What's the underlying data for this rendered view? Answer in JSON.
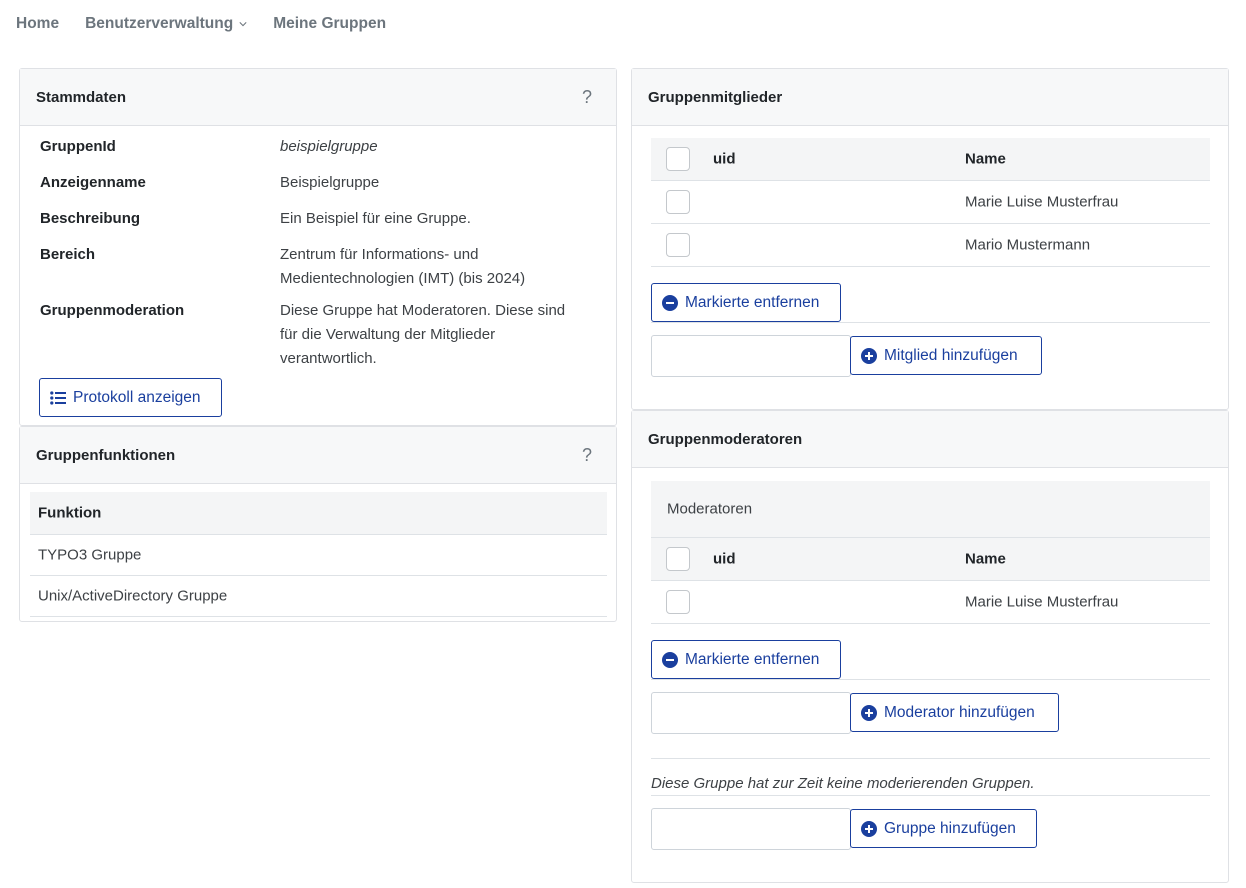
{
  "nav": {
    "home": "Home",
    "benutzerverwaltung": "Benutzerverwaltung",
    "meine_gruppen": "Meine Gruppen"
  },
  "stammdaten": {
    "title": "Stammdaten",
    "help": "?",
    "rows": [
      {
        "key": "GruppenId",
        "value": "beispielgruppe"
      },
      {
        "key": "Anzeigenname",
        "value": "Beispielgruppe"
      },
      {
        "key": "Beschreibung",
        "value": "Ein Beispiel für eine Gruppe."
      },
      {
        "key": "Bereich",
        "value_line1": "Zentrum für Informations- und",
        "value_line2": "Medientechnologien (IMT) (bis 2024)"
      },
      {
        "key": "Gruppenmoderation",
        "value_line1": "Diese Gruppe hat Moderatoren. Diese sind",
        "value_line2": "für die Verwaltung der Mitglieder",
        "value_line3": "verantwortlich."
      }
    ],
    "protokoll_button": "Protokoll anzeigen"
  },
  "gruppenfunktionen": {
    "title": "Gruppenfunktionen",
    "help": "?",
    "column": "Funktion",
    "rows": [
      "TYPO3 Gruppe",
      "Unix/ActiveDirectory Gruppe"
    ]
  },
  "gruppenmitglieder": {
    "title": "Gruppenmitglieder",
    "col_uid": "uid",
    "col_name": "Name",
    "rows": [
      {
        "uid": "",
        "name": "Marie Luise Musterfrau"
      },
      {
        "uid": "",
        "name": "Mario Mustermann"
      }
    ],
    "remove_button": "Markierte entfernen",
    "add_input_value": "",
    "add_button": "Mitglied hinzufügen"
  },
  "gruppenmoderatoren": {
    "title": "Gruppenmoderatoren",
    "section_title": "Moderatoren",
    "col_uid": "uid",
    "col_name": "Name",
    "rows": [
      {
        "uid": "",
        "name": "Marie Luise Musterfrau"
      }
    ],
    "remove_button": "Markierte entfernen",
    "add_input_value": "",
    "add_button": "Moderator hinzufügen",
    "no_groups_note": "Diese Gruppe hat zur Zeit keine moderierenden Gruppen.",
    "group_input_value": "",
    "group_add_button": "Gruppe hinzufügen"
  },
  "colors": {
    "accent": "#1a3f9e",
    "header_bg": "#f7f8f9",
    "border": "#dfe1e5",
    "muted": "#6c757d"
  }
}
